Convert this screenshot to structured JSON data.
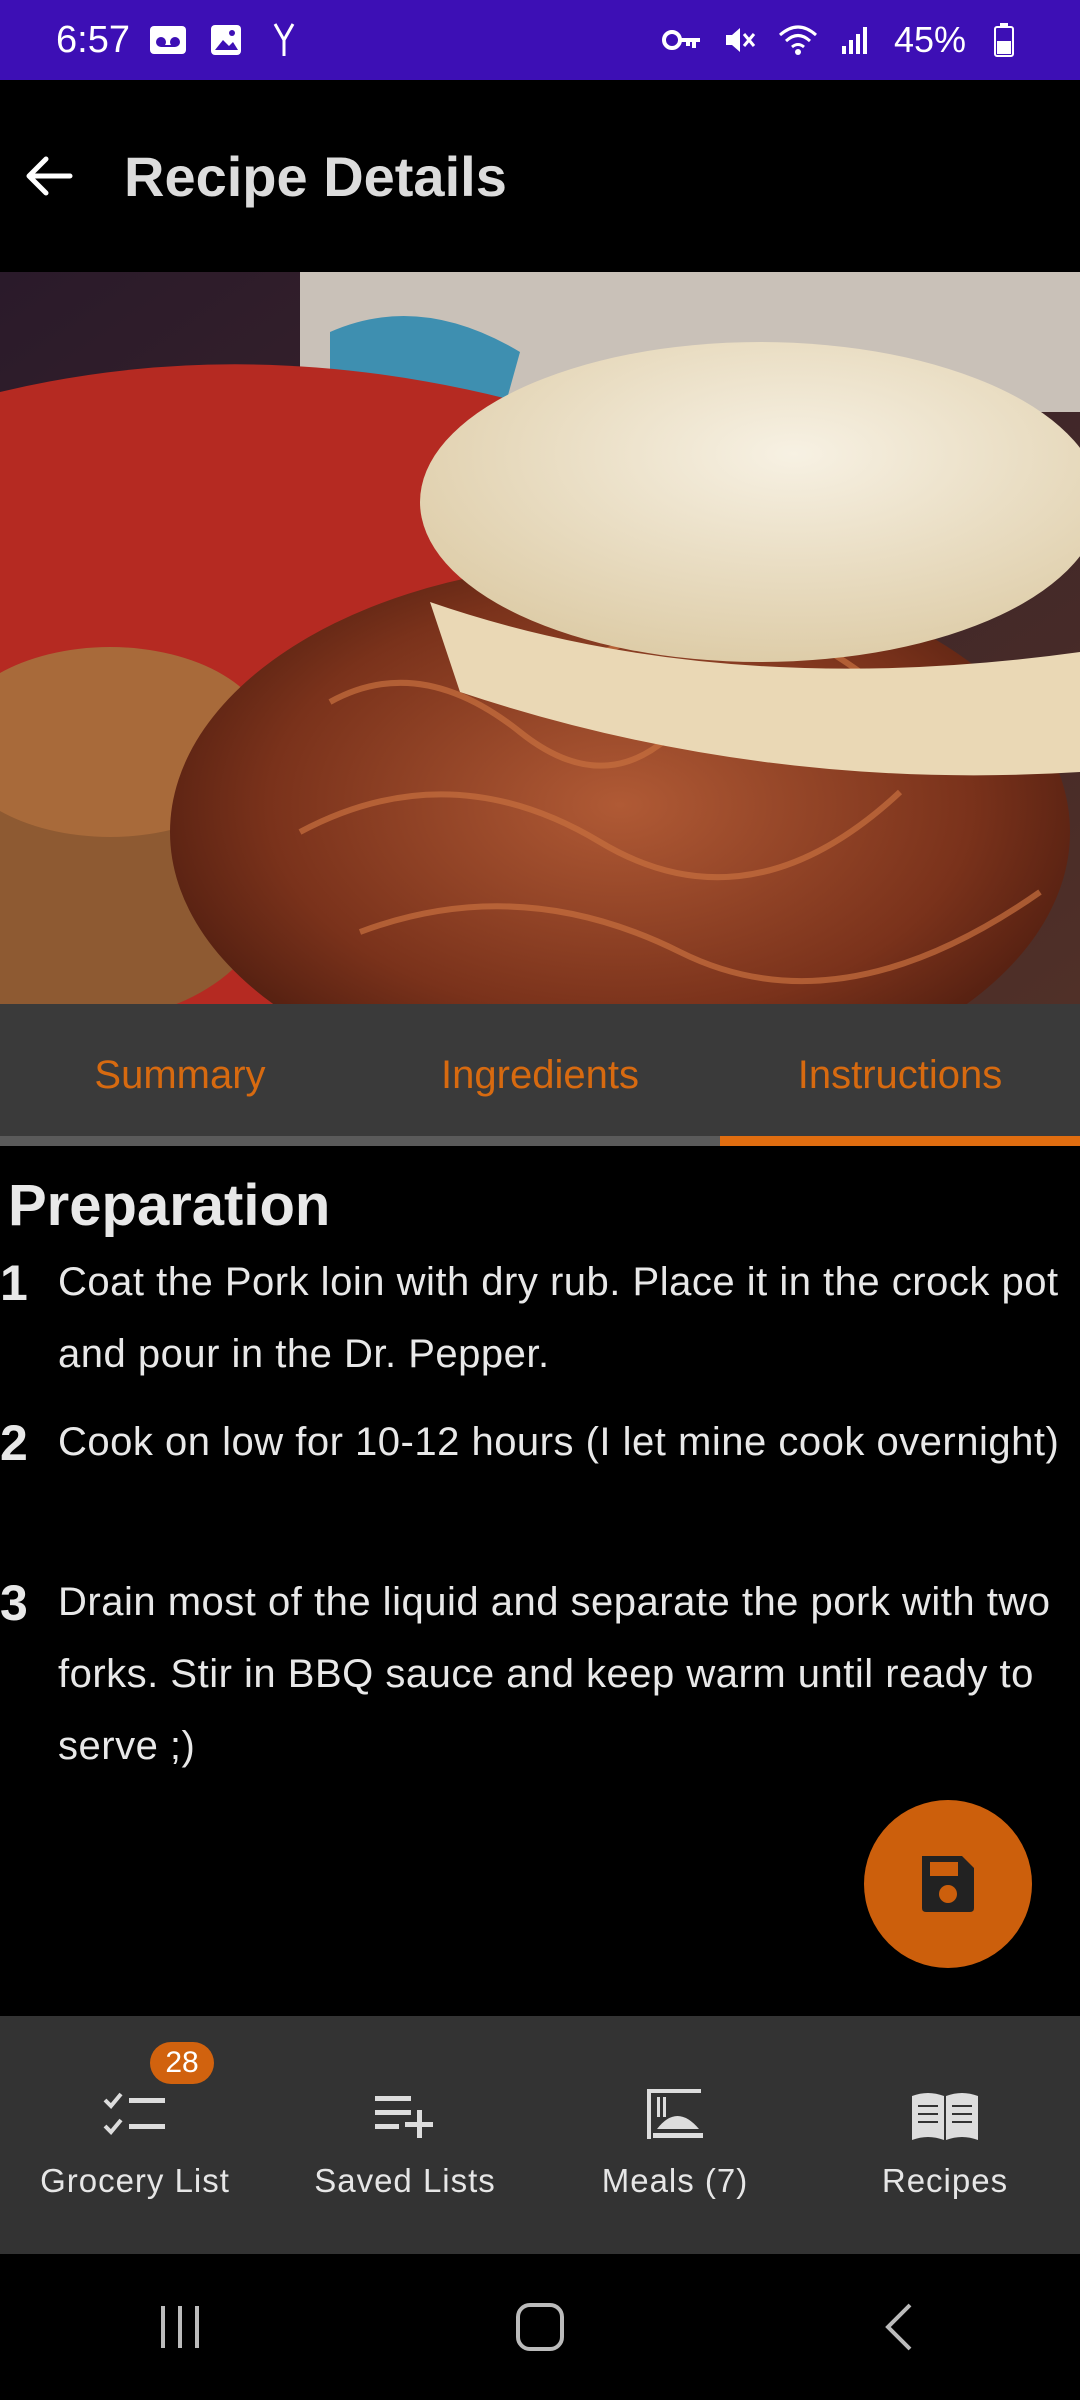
{
  "status_bar": {
    "time": "6:57",
    "battery": "45%"
  },
  "app_bar": {
    "title": "Recipe Details"
  },
  "tabs": [
    {
      "label": "Summary",
      "active": false
    },
    {
      "label": "Ingredients",
      "active": false
    },
    {
      "label": "Instructions",
      "active": true
    }
  ],
  "instructions": {
    "section_title": "Preparation",
    "steps": [
      {
        "number": "1",
        "text": "Coat the Pork loin with dry rub. Place it in the crock pot and pour in the Dr. Pepper."
      },
      {
        "number": "2",
        "text": "Cook on low for 10-12 hours (I let mine cook overnight)"
      },
      {
        "number": "3",
        "text": "Drain most of the liquid and separate the pork with two forks. Stir in BBQ sauce and keep warm until ready to serve ;)"
      }
    ]
  },
  "fab": {
    "icon": "save-icon"
  },
  "bottom_nav": {
    "items": [
      {
        "label": "Grocery List",
        "icon": "checklist-icon",
        "badge": "28"
      },
      {
        "label": "Saved Lists",
        "icon": "playlist-add-icon"
      },
      {
        "label": "Meals (7)",
        "icon": "meal-icon"
      },
      {
        "label": "Recipes",
        "icon": "book-icon"
      }
    ]
  },
  "colors": {
    "status_bar": "#3d0fb5",
    "accent": "#e06d10",
    "tab_bar": "#3a3a3a",
    "nav_bar": "#333333"
  }
}
